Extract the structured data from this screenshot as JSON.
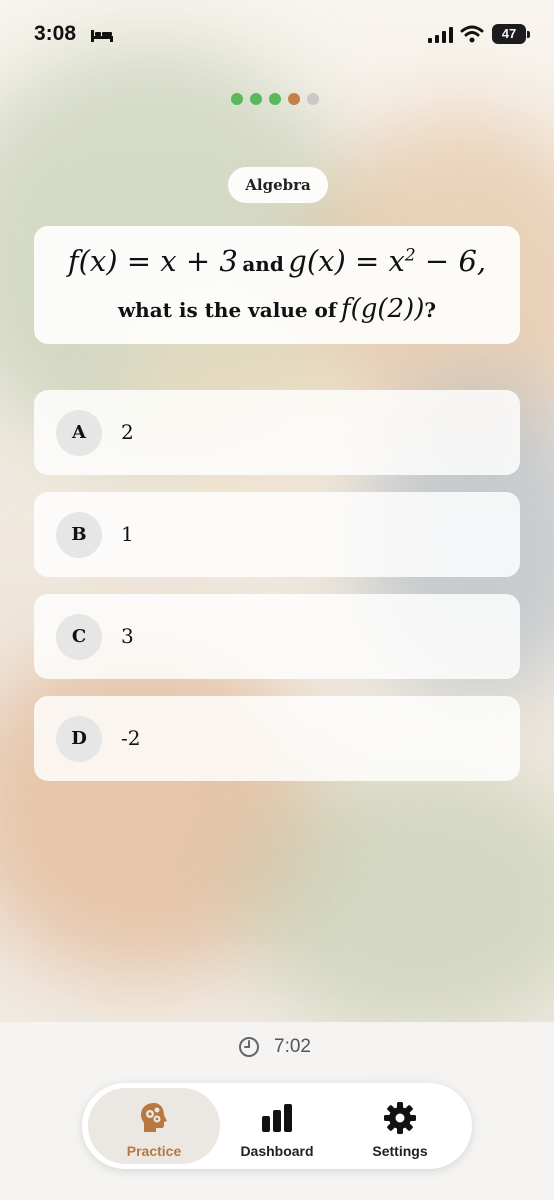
{
  "status_bar": {
    "time": "3:08",
    "battery": "47"
  },
  "progress": {
    "dots": [
      "#58b85c",
      "#58b85c",
      "#58b85c",
      "#c18147",
      "#c9c9c9"
    ]
  },
  "topic": "Algebra",
  "question": {
    "f_expr": "f(x) = x + 3",
    "and_text": "and",
    "g_expr": "g(x) = x",
    "g_sup": "2",
    "g_tail": " − 6,",
    "prompt": "what is the value of",
    "target_expr": "f(g(2))",
    "end": "?"
  },
  "options": [
    {
      "letter": "A",
      "value": "2"
    },
    {
      "letter": "B",
      "value": "1"
    },
    {
      "letter": "C",
      "value": "3"
    },
    {
      "letter": "D",
      "value": "-2"
    }
  ],
  "timer": "7:02",
  "tabs": [
    {
      "label": "Practice",
      "icon": "head-gears-icon",
      "active": true
    },
    {
      "label": "Dashboard",
      "icon": "bar-chart-icon",
      "active": false
    },
    {
      "label": "Settings",
      "icon": "gear-icon",
      "active": false
    }
  ],
  "colors": {
    "accent": "#b8783f",
    "complete": "#58b85c"
  }
}
